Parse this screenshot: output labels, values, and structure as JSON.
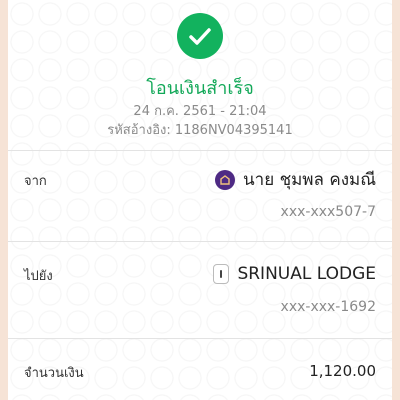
{
  "colors": {
    "success_green": "#12b25e",
    "bank_purple": "#4e2a84",
    "background_peach": "#f6e3d6"
  },
  "header": {
    "icon": "check-icon",
    "title": "โอนเงินสำเร็จ",
    "datetime": "24 ก.ค. 2561 - 21:04",
    "reference": "รหัสอ้างอิง: 1186NV04395141"
  },
  "from": {
    "label": "จาก",
    "icon": "bank-logo-icon",
    "name": "นาย ชุมพล คงมณี",
    "account": "xxx-xxx507-7"
  },
  "to": {
    "label": "ไปยัง",
    "icon": "mobile-phone-icon",
    "name": "SRINUAL LODGE",
    "account": "xxx-xxx-1692"
  },
  "amount": {
    "label": "จำนวนเงิน",
    "value": "1,120.00"
  }
}
